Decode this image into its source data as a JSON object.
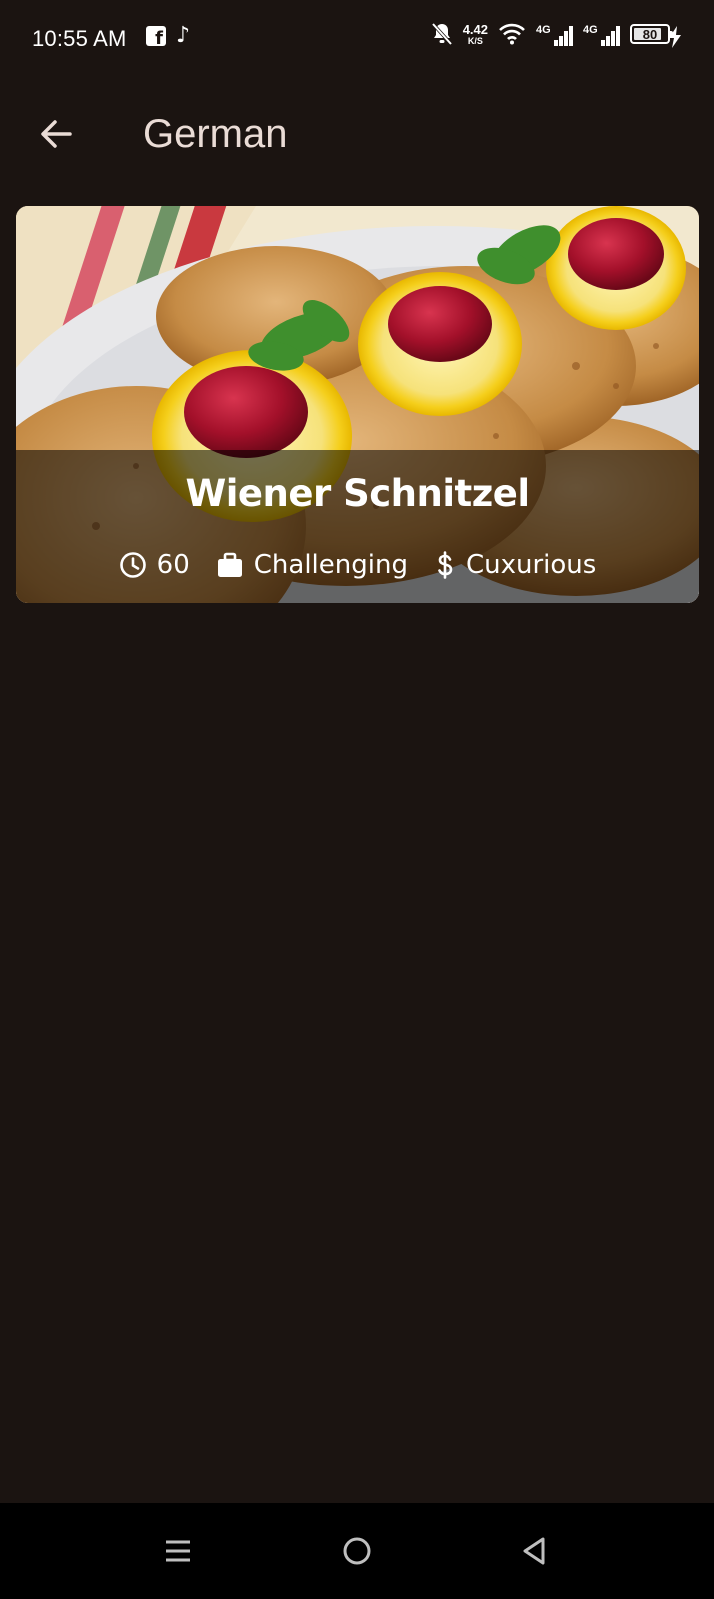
{
  "status_bar": {
    "time": "10:55 AM",
    "speed_value": "4.42",
    "speed_unit": "K/S",
    "network_1": "4G",
    "network_2": "4G",
    "battery": "80",
    "icons": [
      "facebook-icon",
      "tiktok-icon",
      "bell-off-icon",
      "wifi-icon",
      "signal-icon",
      "battery-icon",
      "charging-icon"
    ]
  },
  "app_bar": {
    "title": "German",
    "back_icon": "arrow-left-icon"
  },
  "meals": [
    {
      "title": "Wiener Schnitzel",
      "duration": "60",
      "complexity": "Challenging",
      "affordability": "Cuxurious",
      "icons": [
        "clock-icon",
        "briefcase-icon",
        "dollar-icon"
      ]
    }
  ],
  "colors": {
    "background": "#1b1411",
    "title_text": "#eadcd6",
    "overlay": "rgba(0,0,0,0.55)",
    "nav_bar": "#000000"
  }
}
